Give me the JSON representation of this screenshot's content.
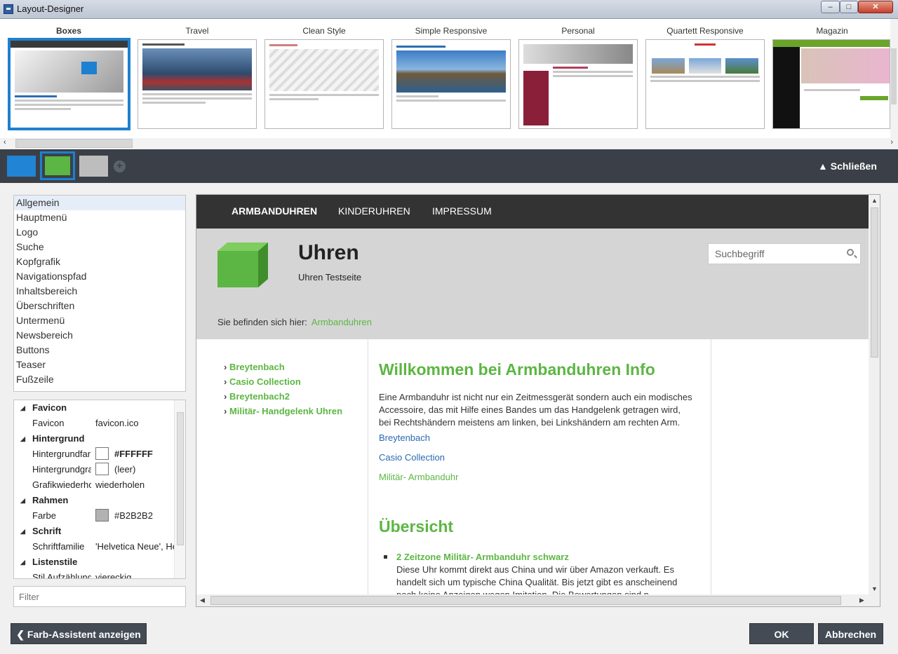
{
  "window": {
    "title": "Layout-Designer",
    "min": "–",
    "max": "□",
    "close": "✕"
  },
  "gallery": {
    "templates": [
      {
        "name": "Boxes",
        "selected": true
      },
      {
        "name": "Travel"
      },
      {
        "name": "Clean Style"
      },
      {
        "name": "Simple Responsive"
      },
      {
        "name": "Personal"
      },
      {
        "name": "Quartett Responsive"
      },
      {
        "name": "Magazin"
      }
    ],
    "scroll_left": "‹",
    "scroll_right": "›"
  },
  "colors": {
    "swatches": [
      "#2184d4",
      "#5cb643",
      "#bdbdbd"
    ],
    "selected_swatch": 1,
    "add": "+",
    "close_label": "Schließen",
    "close_icon": "chevron-up-icon"
  },
  "nav": {
    "items": [
      "Allgemein",
      "Hauptmenü",
      "Logo",
      "Suche",
      "Kopfgrafik",
      "Navigationspfad",
      "Inhaltsbereich",
      "Überschriften",
      "Untermenü",
      "Newsbereich",
      "Buttons",
      "Teaser",
      "Fußzeile"
    ],
    "selected": 0
  },
  "props": {
    "favicon_cat": "Favicon",
    "favicon_key": "Favicon",
    "favicon_val": "favicon.ico",
    "bg_cat": "Hintergrund",
    "bg_color_key": "Hintergrundfarbe",
    "bg_color_val": "#FFFFFF",
    "bg_image_key": "Hintergrundgrafik",
    "bg_image_val": "(leer)",
    "bg_repeat_key": "Grafikwiederholung",
    "bg_repeat_val": "wiederholen",
    "border_cat": "Rahmen",
    "border_color_key": "Farbe",
    "border_color_val": "#B2B2B2",
    "font_cat": "Schrift",
    "font_family_key": "Schriftfamilie",
    "font_family_val": "'Helvetica Neue', Helvetica",
    "list_cat": "Listenstile",
    "list_style_key": "Stil Aufzählung",
    "list_style_val": "viereckig"
  },
  "filter": {
    "placeholder": "Filter"
  },
  "preview": {
    "nav": [
      "ARMBANDUHREN",
      "KINDERUHREN",
      "IMPRESSUM"
    ],
    "site_title": "Uhren",
    "site_subtitle": "Uhren Testseite",
    "search_placeholder": "Suchbegriff",
    "crumb_label": "Sie befinden sich hier:",
    "crumb_current": "Armbanduhren",
    "submenu": [
      "Breytenbach",
      "Casio Collection",
      "Breytenbach2",
      "Militär- Handgelenk Uhren"
    ],
    "heading": "Willkommen bei Armbanduhren Info",
    "intro": "Eine Armbanduhr ist nicht nur ein Zeitmessgerät sondern auch ein modisches Accessoire, das mit Hilfe eines Bandes um das Handgelenk getragen wird, bei Rechtshändern meistens am linken, bei Linkshändern am rechten Arm.",
    "links": [
      "Breytenbach",
      "Casio Collection",
      "Militär- Armbanduhr"
    ],
    "overview_heading": "Übersicht",
    "overview_item_title": "2 Zeitzone Militär- Armbanduhr schwarz",
    "overview_item_text": "Diese Uhr kommt direkt aus China und wir über Amazon verkauft. Es handelt sich um typische China Qualität. Bis jetzt gibt es anscheinend noch keine Anzeigen wegen Imitation. Die Bewertungen sind n...",
    "accent": "#5cb643",
    "link_color": "#2a6ab0"
  },
  "buttons": {
    "farb": "Farb-Assistent anzeigen",
    "ok": "OK",
    "cancel": "Abbrechen"
  }
}
